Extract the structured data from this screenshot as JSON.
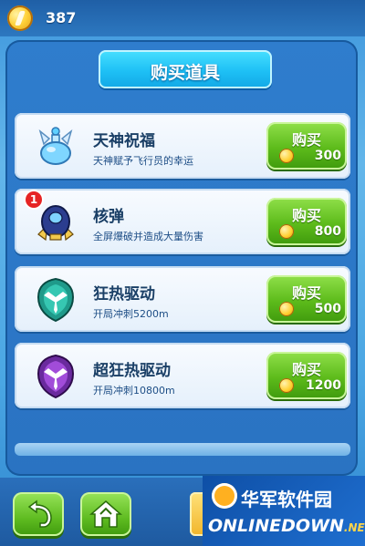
{
  "top": {
    "coin_icon": "gold-coin-icon",
    "coins": "387"
  },
  "title": "购买道具",
  "items": [
    {
      "name": "天神祝福",
      "desc": "天神赋予飞行员的幸运",
      "buy": "购买",
      "price": "300",
      "icon": "blessing-flask-icon"
    },
    {
      "name": "核弹",
      "desc": "全屏爆破并造成大量伤害",
      "buy": "购买",
      "price": "800",
      "icon": "nuke-bomb-icon",
      "badge": "1"
    },
    {
      "name": "狂热驱动",
      "desc": "开局冲刺5200m",
      "buy": "购买",
      "price": "500",
      "icon": "green-shield-icon"
    },
    {
      "name": "超狂热驱动",
      "desc": "开局冲刺10800m",
      "buy": "购买",
      "price": "1200",
      "icon": "purple-shield-icon"
    }
  ],
  "nav": {
    "back_icon": "back-arrow-icon",
    "home_icon": "home-icon"
  },
  "watermark": {
    "cn": "华军软件园",
    "en": "ONLINEDOWN",
    "net": ".NET"
  },
  "colors": {
    "background": "#4aa6e3",
    "buy_button": "#5dbb1b",
    "title_box": "#1ec0f5",
    "badge": "#e62424"
  }
}
